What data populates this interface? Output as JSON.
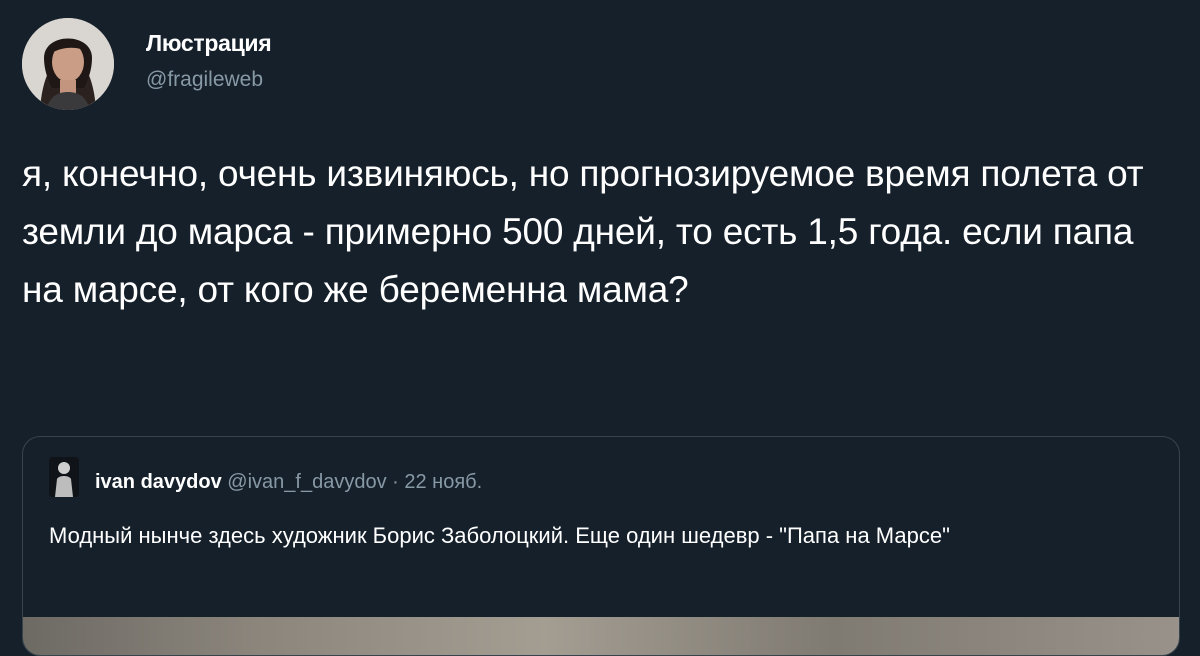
{
  "tweet": {
    "author": {
      "display_name": "Люстрация",
      "handle": "@fragileweb"
    },
    "text": "я, конечно, очень извиняюсь, но прогнозируемое время полета от земли до марса - примерно 500 дней, то есть 1,5 года. если папа на марсе, от кого же беременна мама?",
    "quoted_tweet": {
      "author_name": "ivan davydov",
      "author_handle": "@ivan_f_davydov",
      "separator": "·",
      "date": "22 нояб.",
      "text": "Модный нынче здесь художник Борис Заболоцкий. Еще один шедевр - \"Папа на Марсе\""
    }
  },
  "colors": {
    "background": "#15202b",
    "secondary_text": "#8899a6",
    "border": "#38444d"
  }
}
